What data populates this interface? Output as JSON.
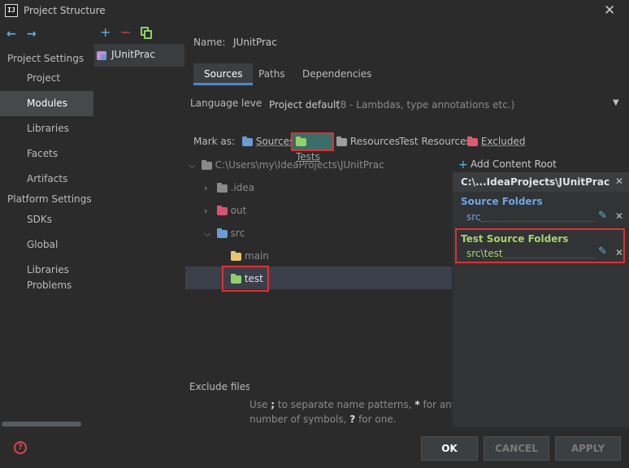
{
  "window": {
    "title": "Project Structure",
    "logo": "IJ",
    "close": "✕"
  },
  "nav": {
    "back": "←",
    "forward": "→",
    "project_settings": "Project Settings",
    "project_items": [
      "Project",
      "Modules",
      "Libraries",
      "Facets",
      "Artifacts"
    ],
    "platform_settings": "Platform Settings",
    "platform_items": [
      "SDKs",
      "Global Libraries"
    ],
    "problems": "Problems",
    "selected": "Modules",
    "help_icon": "?"
  },
  "modules": {
    "add": "+",
    "remove": "−",
    "copy_icon": "copy-icon",
    "list": [
      "JUnitPrac"
    ]
  },
  "main": {
    "name_label": "Name:",
    "name_value": "JUnitPrac",
    "tabs": [
      "Sources",
      "Paths",
      "Dependencies"
    ],
    "active_tab": "Sources",
    "language_level_label": "Language level:",
    "language_level_value": "Project default",
    "language_level_hint": "(8 - Lambdas, type annotations etc.)",
    "mark_as_label": "Mark as:",
    "mark_as": [
      {
        "label": "Sources",
        "color": "#6b9bd2"
      },
      {
        "label": "Tests",
        "color": "#8fd16a"
      },
      {
        "label": "Resources",
        "color": "#9e9e9e"
      },
      {
        "label": "Test Resources",
        "color": ""
      },
      {
        "label": "Excluded",
        "color": "#e05a6e"
      }
    ],
    "tree": {
      "root": "C:\\Users\\my\\IdeaProjects\\JUnitPrac",
      "idea": ".idea",
      "out": "out",
      "src": "src",
      "main": "main",
      "test": "test"
    },
    "exclude_label": "Exclude files:",
    "exclude_hint_1a": "Use",
    "exclude_hint_1b": ";",
    "exclude_hint_1c": "to separate name patterns,",
    "exclude_hint_1d": "*",
    "exclude_hint_1e": "for any",
    "exclude_hint_2a": "number of symbols,",
    "exclude_hint_2b": "?",
    "exclude_hint_2c": "for one."
  },
  "side": {
    "add_root": "Add Content Root",
    "root_path": "C:\\...IdeaProjects\\JUnitPrac",
    "source_folders_title": "Source Folders",
    "source_folders": [
      "src"
    ],
    "test_folders_title": "Test Source Folders",
    "test_folders": [
      "src\\test"
    ]
  },
  "buttons": {
    "ok": "OK",
    "cancel": "CANCEL",
    "apply": "APPLY"
  },
  "colors": {
    "accent": "#4a88c7",
    "highlight": "#e03030",
    "source_title": "#6aa6e8",
    "test_title": "#a8d36b",
    "folder_grey": "#8a8a8a",
    "folder_red": "#d9546e",
    "folder_blue": "#6b9bd2",
    "folder_yellow": "#e8c46a",
    "folder_green": "#8fd16a"
  }
}
